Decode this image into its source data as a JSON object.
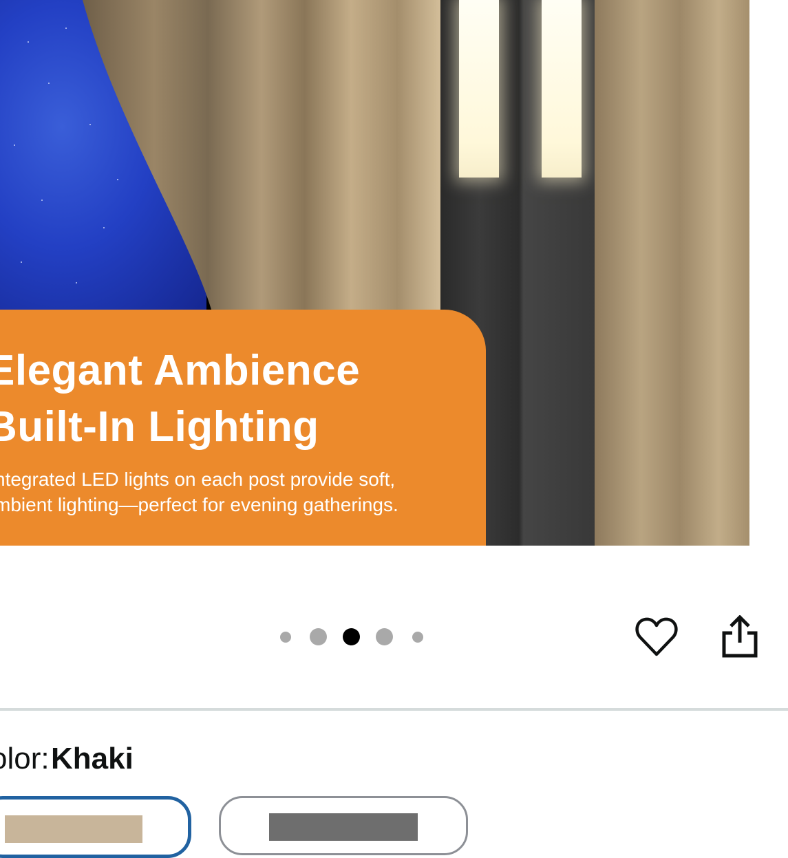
{
  "hero": {
    "headline_line1": "Elegant Ambience",
    "headline_line2": "Built-In Lighting",
    "subline_line1": "ntegrated LED lights on each post provide soft,",
    "subline_line2": "mbient lighting—perfect for evening gatherings.",
    "banner_color": "#ec8a2c"
  },
  "carousel": {
    "total_dots": 5,
    "active_index": 2
  },
  "actions": {
    "wishlist_icon": "heart-icon",
    "share_icon": "share-icon"
  },
  "variation": {
    "label": "olor:",
    "selected_value": "Khaki",
    "swatches": [
      {
        "name": "Khaki",
        "color": "#c8b59a",
        "selected": true
      },
      {
        "name": "Gray",
        "color": "#6e6e6e",
        "selected": false
      }
    ],
    "selected_border_color": "#2162a1"
  }
}
